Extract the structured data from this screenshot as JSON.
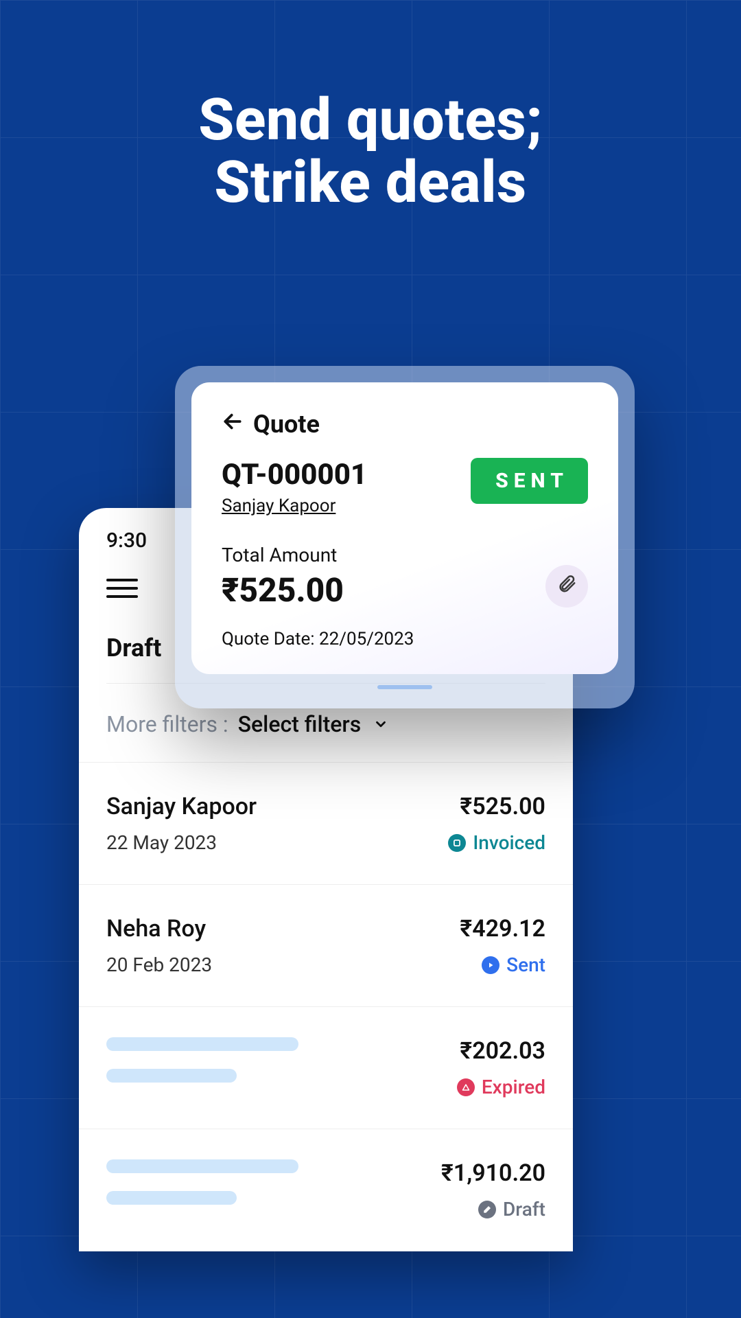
{
  "headline": {
    "line1": "Send quotes;",
    "line2": "Strike deals"
  },
  "statusbar": {
    "time": "9:30"
  },
  "tabs": {
    "draft_label": "Draft"
  },
  "filters": {
    "label": "More filters  :",
    "value": "Select filters"
  },
  "quotes": [
    {
      "name": "Sanjay Kapoor",
      "date": "22 May 2023",
      "amount": "₹525.00",
      "status": "Invoiced",
      "status_kind": "invoiced"
    },
    {
      "name": "Neha Roy",
      "date": "20 Feb 2023",
      "amount": "₹429.12",
      "status": "Sent",
      "status_kind": "sent"
    },
    {
      "name": "",
      "date": "",
      "amount": "₹202.03",
      "status": "Expired",
      "status_kind": "expired"
    },
    {
      "name": "",
      "date": "",
      "amount": "₹1,910.20",
      "status": "Draft",
      "status_kind": "draft"
    }
  ],
  "detail": {
    "section_title": "Quote",
    "quote_id": "QT-000001",
    "client_name": "Sanjay Kapoor",
    "status_badge": "SENT",
    "total_label": "Total Amount",
    "total_amount": "₹525.00",
    "date_label": "Quote Date: 22/05/2023"
  }
}
